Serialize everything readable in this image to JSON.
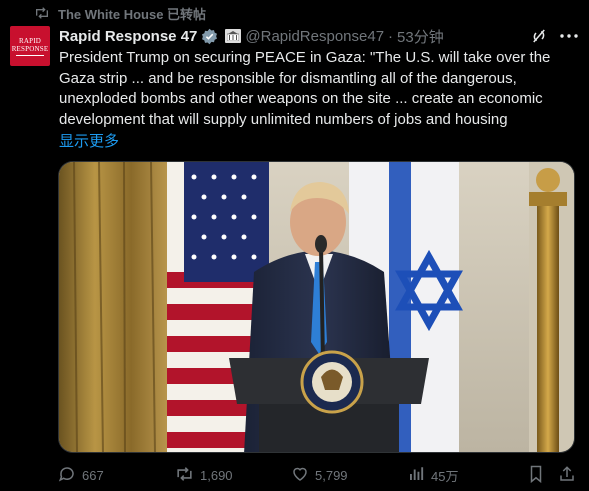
{
  "repost": {
    "label": "The White House 已转帖"
  },
  "author": {
    "avatar_text_line1": "RAPID",
    "avatar_text_line2": "RESPONSE",
    "display_name": "Rapid Response 47",
    "handle": "@RapidResponse47",
    "separator": "·",
    "time": "53分钟",
    "verified_badge_color": "#829aab"
  },
  "tweet": {
    "text": "President Trump on securing PEACE in Gaza: \"The U.S. will take over the Gaza strip ... and be responsible for dismantling all of the dangerous, unexploded bombs and other weapons on the site ... create an economic development that will supply unlimited numbers of jobs and housing",
    "show_more": "显示更多"
  },
  "media": {
    "description_icon": "video-still",
    "podium_seal": "presidential-seal"
  },
  "actions": {
    "replies": "667",
    "reposts": "1,690",
    "likes": "5,799",
    "views": "45万"
  },
  "colors": {
    "background": "#000000",
    "text": "#e7e9ea",
    "muted": "#71767b",
    "link": "#1d9bf0",
    "brand_red": "#c8102e"
  }
}
